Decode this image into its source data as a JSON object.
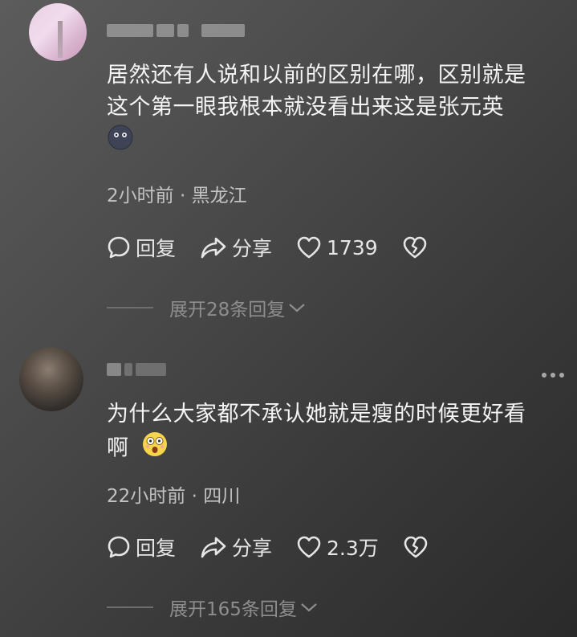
{
  "comments": [
    {
      "text_line1": "居然还有人说和以前的区别在哪，区别就是",
      "text_line2": "这个第一眼我根本就没看出来这是张元英",
      "emoji": "dizzy-face-emoji",
      "time": "2小时前",
      "location": "黑龙江",
      "reply_label": "回复",
      "share_label": "分享",
      "likes": "1739",
      "expand_label": "展开28条回复"
    },
    {
      "text_line1": "为什么大家都不承认她就是瘦的时候更好看",
      "text_line2": "啊",
      "emoji": "surprised-face-emoji",
      "time": "22小时前",
      "location": "四川",
      "reply_label": "回复",
      "share_label": "分享",
      "likes": "2.3万",
      "expand_label": "展开165条回复"
    }
  ],
  "separator": "·",
  "icons": [
    "comment-bubble-icon",
    "share-arrow-icon",
    "heart-icon",
    "broken-heart-icon",
    "chevron-down-icon",
    "more-icon"
  ]
}
